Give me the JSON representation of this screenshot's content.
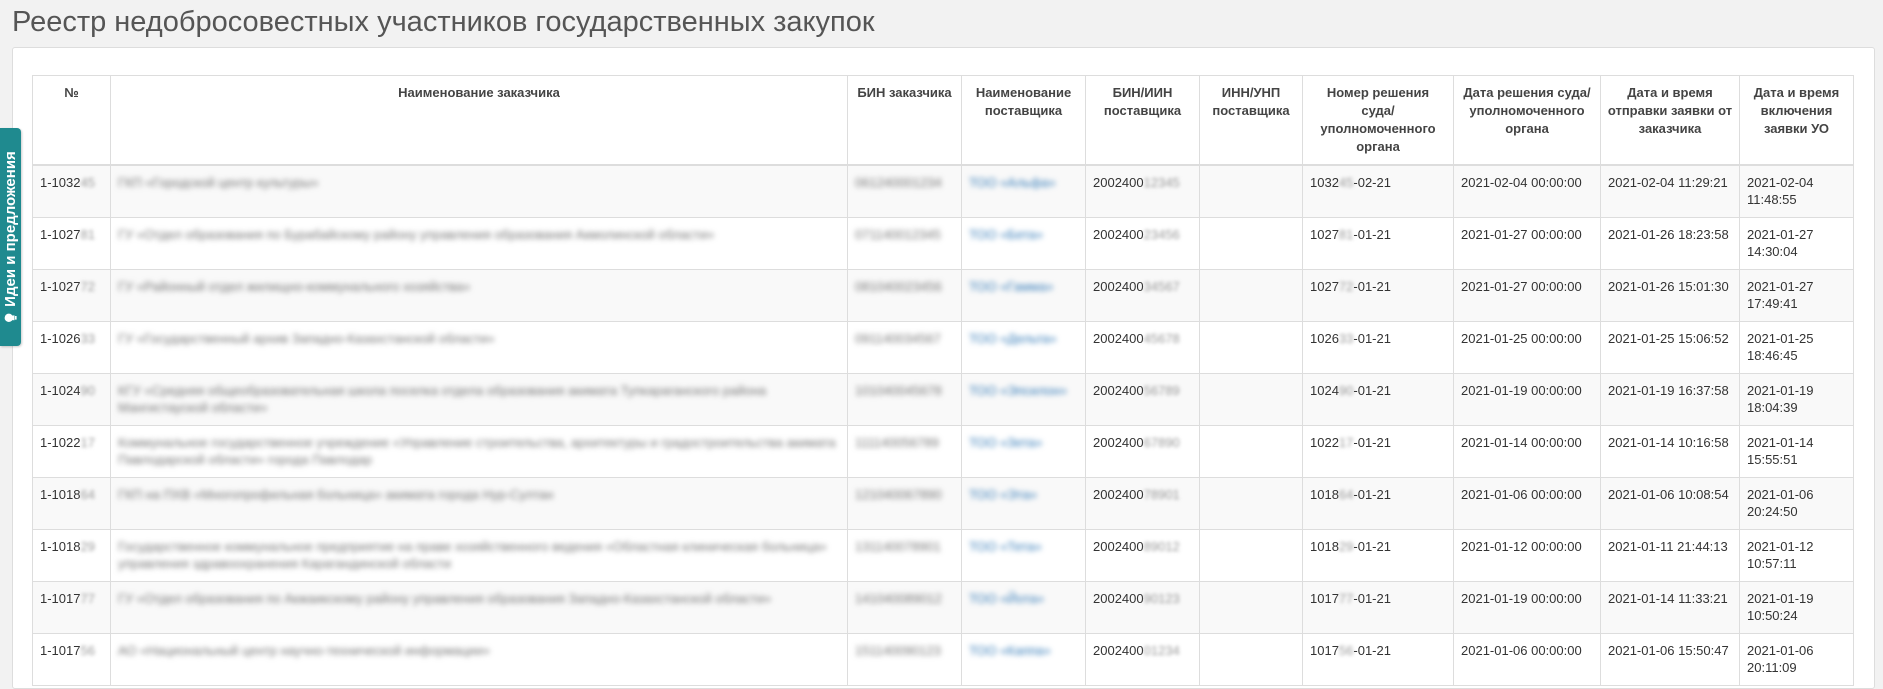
{
  "page": {
    "title": "Реестр недобросовестных участников государственных закупок",
    "feedback_tab": "Идеи и предложения"
  },
  "table": {
    "headers": [
      "№",
      "Наименование заказчика",
      "БИН заказчика",
      "Наименование поставщика",
      "БИН/ИИН поставщика",
      "ИНН/УНП поставщика",
      "Номер решения суда/ уполномоченного органа",
      "Дата решения суда/ уполномоченного органа",
      "Дата и время отправки заявки от заказчика",
      "Дата и время включения заявки УО"
    ],
    "rows": [
      {
        "num_prefix": "1-1032",
        "num_hidden": "45",
        "customer_name": "ГКП «Городской центр культуры»",
        "customer_bin": "061240001234",
        "supplier_name": "ТОО «Альфа»",
        "supplier_bin_prefix": "2002400",
        "supplier_bin_hidden": "12345",
        "inn": "",
        "decision_prefix": "1032",
        "decision_hidden": "45",
        "decision_suffix": "-02-21",
        "decision_date": "2021-02-04 00:00:00",
        "sent_at": "2021-02-04 11:29:21",
        "included_date": "2021-02-04",
        "included_time": "11:48:55"
      },
      {
        "num_prefix": "1-1027",
        "num_hidden": "81",
        "customer_name": "ГУ «Отдел образования по Бурабайскому району управления образования Акмолинской области»",
        "customer_bin": "071140012345",
        "supplier_name": "ТОО «Бета»",
        "supplier_bin_prefix": "2002400",
        "supplier_bin_hidden": "23456",
        "inn": "",
        "decision_prefix": "1027",
        "decision_hidden": "81",
        "decision_suffix": "-01-21",
        "decision_date": "2021-01-27 00:00:00",
        "sent_at": "2021-01-26 18:23:58",
        "included_date": "2021-01-27",
        "included_time": "14:30:04"
      },
      {
        "num_prefix": "1-1027",
        "num_hidden": "72",
        "customer_name": "ГУ «Районный отдел жилищно-коммунального хозяйства»",
        "customer_bin": "081040023456",
        "supplier_name": "ТОО «Гамма»",
        "supplier_bin_prefix": "2002400",
        "supplier_bin_hidden": "34567",
        "inn": "",
        "decision_prefix": "1027",
        "decision_hidden": "72",
        "decision_suffix": "-01-21",
        "decision_date": "2021-01-27 00:00:00",
        "sent_at": "2021-01-26 15:01:30",
        "included_date": "2021-01-27",
        "included_time": "17:49:41"
      },
      {
        "num_prefix": "1-1026",
        "num_hidden": "33",
        "customer_name": "ГУ «Государственный архив Западно-Казахстанской области»",
        "customer_bin": "091140034567",
        "supplier_name": "ТОО «Дельта»",
        "supplier_bin_prefix": "2002400",
        "supplier_bin_hidden": "45678",
        "inn": "",
        "decision_prefix": "1026",
        "decision_hidden": "33",
        "decision_suffix": "-01-21",
        "decision_date": "2021-01-25 00:00:00",
        "sent_at": "2021-01-25 15:06:52",
        "included_date": "2021-01-25",
        "included_time": "18:46:45"
      },
      {
        "num_prefix": "1-1024",
        "num_hidden": "90",
        "customer_name": "КГУ «Средняя общеобразовательная школа поселка отдела образования акимата Тупкараганского района Мангистауской области»",
        "customer_bin": "101040045678",
        "supplier_name": "ТОО «Эпсилон»",
        "supplier_bin_prefix": "2002400",
        "supplier_bin_hidden": "56789",
        "inn": "",
        "decision_prefix": "1024",
        "decision_hidden": "90",
        "decision_suffix": "-01-21",
        "decision_date": "2021-01-19 00:00:00",
        "sent_at": "2021-01-19 16:37:58",
        "included_date": "2021-01-19",
        "included_time": "18:04:39"
      },
      {
        "num_prefix": "1-1022",
        "num_hidden": "17",
        "customer_name": "Коммунальное государственное учреждение «Управление строительства, архитектуры и градостроительства акимата Павлодарской области» города Павлодар",
        "customer_bin": "111140056789",
        "supplier_name": "ТОО «Зета»",
        "supplier_bin_prefix": "2002400",
        "supplier_bin_hidden": "67890",
        "inn": "",
        "decision_prefix": "1022",
        "decision_hidden": "17",
        "decision_suffix": "-01-21",
        "decision_date": "2021-01-14 00:00:00",
        "sent_at": "2021-01-14 10:16:58",
        "included_date": "2021-01-14",
        "included_time": "15:55:51"
      },
      {
        "num_prefix": "1-1018",
        "num_hidden": "64",
        "customer_name": "ГКП на ПХВ «Многопрофильная больница» акимата города Нур-Султан",
        "customer_bin": "121040067890",
        "supplier_name": "ТОО «Эта»",
        "supplier_bin_prefix": "2002400",
        "supplier_bin_hidden": "78901",
        "inn": "",
        "decision_prefix": "1018",
        "decision_hidden": "64",
        "decision_suffix": "-01-21",
        "decision_date": "2021-01-06 00:00:00",
        "sent_at": "2021-01-06 10:08:54",
        "included_date": "2021-01-06",
        "included_time": "20:24:50"
      },
      {
        "num_prefix": "1-1018",
        "num_hidden": "29",
        "customer_name": "Государственное коммунальное предприятие на праве хозяйственного ведения «Областная клиническая больница» управления здравоохранения Карагандинской области",
        "customer_bin": "131140078901",
        "supplier_name": "ТОО «Тета»",
        "supplier_bin_prefix": "2002400",
        "supplier_bin_hidden": "89012",
        "inn": "",
        "decision_prefix": "1018",
        "decision_hidden": "29",
        "decision_suffix": "-01-21",
        "decision_date": "2021-01-12 00:00:00",
        "sent_at": "2021-01-11 21:44:13",
        "included_date": "2021-01-12",
        "included_time": "10:57:11"
      },
      {
        "num_prefix": "1-1017",
        "num_hidden": "77",
        "customer_name": "ГУ «Отдел образования по Акжаикскому району управления образования Западно-Казахстанской области»",
        "customer_bin": "141040089012",
        "supplier_name": "ТОО «Йота»",
        "supplier_bin_prefix": "2002400",
        "supplier_bin_hidden": "90123",
        "inn": "",
        "decision_prefix": "1017",
        "decision_hidden": "77",
        "decision_suffix": "-01-21",
        "decision_date": "2021-01-19 00:00:00",
        "sent_at": "2021-01-14 11:33:21",
        "included_date": "2021-01-19",
        "included_time": "10:50:24"
      },
      {
        "num_prefix": "1-1017",
        "num_hidden": "56",
        "customer_name": "АО «Национальный центр научно-технической информации»",
        "customer_bin": "151140090123",
        "supplier_name": "ТОО «Каппа»",
        "supplier_bin_prefix": "2002400",
        "supplier_bin_hidden": "01234",
        "inn": "",
        "decision_prefix": "1017",
        "decision_hidden": "56",
        "decision_suffix": "-01-21",
        "decision_date": "2021-01-06 00:00:00",
        "sent_at": "2021-01-06 15:50:47",
        "included_date": "2021-01-06",
        "included_time": "20:11:09"
      }
    ]
  }
}
